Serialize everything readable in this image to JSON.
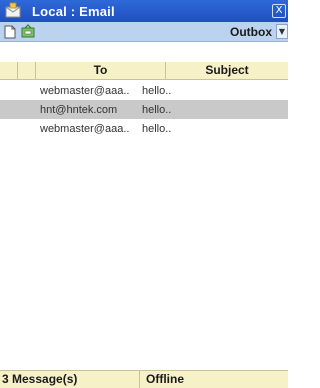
{
  "window": {
    "title": "Local : Email",
    "close_label": "X",
    "app_icon": "mail-app-icon"
  },
  "toolbar": {
    "icons": [
      "new-message-icon",
      "send-receive-icon"
    ],
    "folder_selected": "Outbox",
    "dropdown_glyph": "▼"
  },
  "list": {
    "columns": [
      "",
      "",
      "To",
      "Subject"
    ],
    "rows": [
      {
        "to": "webmaster@aaa..",
        "subject": "hello..",
        "selected": false
      },
      {
        "to": "hnt@hntek.com",
        "subject": "hello..",
        "selected": true
      },
      {
        "to": "webmaster@aaa..",
        "subject": "hello..",
        "selected": false
      }
    ]
  },
  "status": {
    "count": "3 Message(s)",
    "mode": "Offline"
  },
  "colors": {
    "titlebar": "#1f4fc0",
    "toolbar": "#bcd3f0",
    "header": "#f7f1c8",
    "selected_row": "#c9c9c9"
  }
}
